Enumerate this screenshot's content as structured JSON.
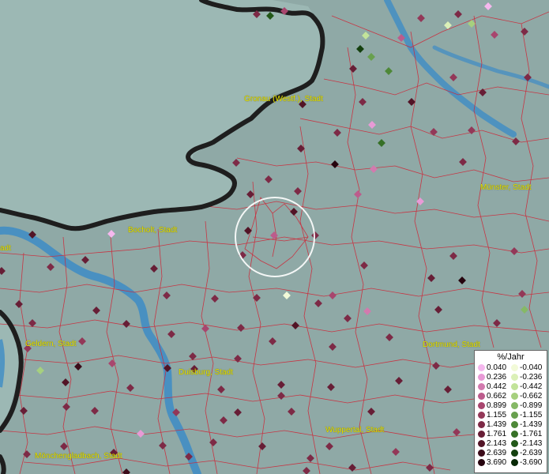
{
  "colors": {
    "water": "#3d8cc6",
    "land": "#8fa9a6",
    "border_outer": "#1a1a1a",
    "districts": "#cc2a3a",
    "city_label": "#e8e400",
    "highlight_circle": "#ffffff"
  },
  "cities": [
    {
      "name": "Gronau (Westf.), Stadt"
    },
    {
      "name": "Münster, Stadt"
    },
    {
      "name": "Bocholt, Stadt"
    },
    {
      "name": "Geldern, Stadt"
    },
    {
      "name": "Dortmund, Stadt"
    },
    {
      "name": "Duisburg, Stadt"
    },
    {
      "name": "Wuppertal, Stadt"
    },
    {
      "name": "Mönchengladbach, Stadt"
    },
    {
      "name": "adt"
    }
  ],
  "legend": {
    "title": "%/Jahr",
    "positive": [
      {
        "value": "0.040",
        "color": "#f5b8ee"
      },
      {
        "value": "0.236",
        "color": "#e89ad6"
      },
      {
        "value": "0.442",
        "color": "#d27aae"
      },
      {
        "value": "0.662",
        "color": "#bc5c8c"
      },
      {
        "value": "0.899",
        "color": "#a8466e"
      },
      {
        "value": "1.155",
        "color": "#933858"
      },
      {
        "value": "1.439",
        "color": "#7d2a46"
      },
      {
        "value": "1.761",
        "color": "#671e36"
      },
      {
        "value": "2.143",
        "color": "#521426"
      },
      {
        "value": "2.639",
        "color": "#3c0c1a"
      },
      {
        "value": "3.690",
        "color": "#26040e"
      }
    ],
    "negative": [
      {
        "value": "-0.040",
        "color": "#f2fad8"
      },
      {
        "value": "-0.236",
        "color": "#dbf0b8"
      },
      {
        "value": "-0.442",
        "color": "#c2e39a"
      },
      {
        "value": "-0.662",
        "color": "#a6d07e"
      },
      {
        "value": "-0.899",
        "color": "#86b966"
      },
      {
        "value": "-1.155",
        "color": "#68a04e"
      },
      {
        "value": "-1.439",
        "color": "#4e8838"
      },
      {
        "value": "-1.761",
        "color": "#367026"
      },
      {
        "value": "-2.143",
        "color": "#225818"
      },
      {
        "value": "-2.639",
        "color": "#14400e"
      },
      {
        "value": "-3.690",
        "color": "#082806"
      }
    ]
  }
}
